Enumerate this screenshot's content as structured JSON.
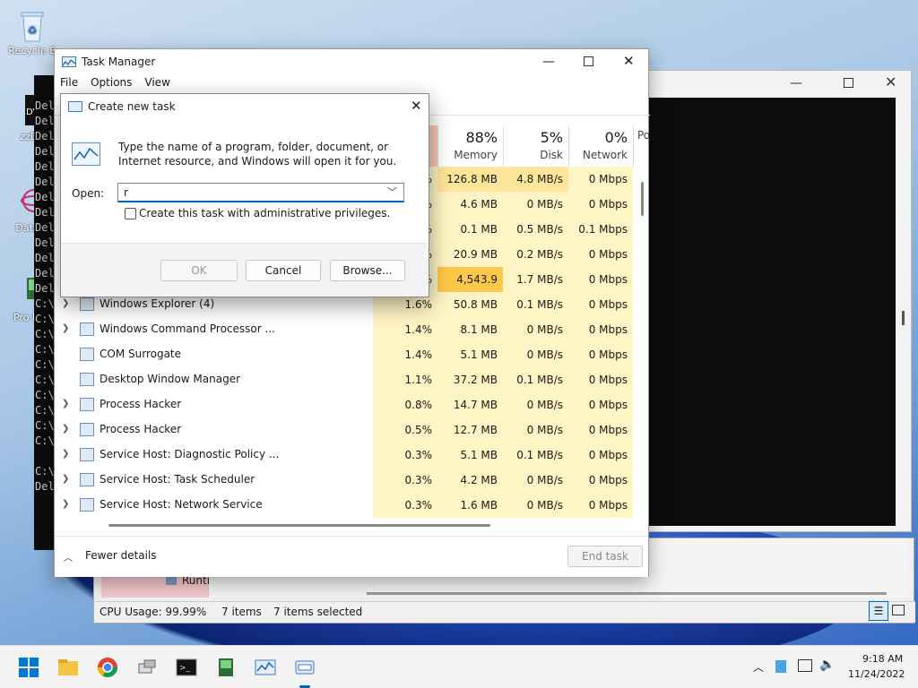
{
  "desktop": {
    "icons": [
      {
        "label": "Recycle B"
      },
      {
        "label": "zzDV"
      },
      {
        "label": "DataW"
      },
      {
        "label": "Pro Hac"
      }
    ],
    "cmd_lines": [
      "Del",
      "Del",
      "Del",
      "Del",
      "Del",
      "Del",
      "Del",
      "Del",
      "Del",
      "Del",
      "Del",
      "Del",
      "Del",
      "C:\\",
      "C:\\",
      "C:\\",
      "C:\\",
      "C:\\",
      "C:\\",
      "C:\\",
      "C:\\",
      "C:\\",
      "C:\\",
      "",
      "C:\\",
      "Del"
    ]
  },
  "task_manager": {
    "title": "Task Manager",
    "menu": [
      "File",
      "Options",
      "View"
    ],
    "columns": [
      {
        "pct": "88%",
        "name": "Memory"
      },
      {
        "pct": "5%",
        "name": "Disk"
      },
      {
        "pct": "0%",
        "name": "Network"
      },
      {
        "pct": "",
        "name": "Po"
      }
    ],
    "rows": [
      {
        "name": "",
        "cpu": "%",
        "mem": "126.8 MB",
        "disk": "4.8 MB/s",
        "net": "0 Mbps",
        "expand": false
      },
      {
        "name": "",
        "cpu": "%",
        "mem": "4.6 MB",
        "disk": "0 MB/s",
        "net": "0 Mbps",
        "expand": false
      },
      {
        "name": "",
        "cpu": "%",
        "mem": "0.1 MB",
        "disk": "0.5 MB/s",
        "net": "0.1 Mbps",
        "expand": false
      },
      {
        "name": "",
        "cpu": "%",
        "mem": "20.9 MB",
        "disk": "0.2 MB/s",
        "net": "0 Mbps",
        "expand": false
      },
      {
        "name": "",
        "cpu": "%",
        "mem": "4,543.9 MB",
        "disk": "1.7 MB/s",
        "net": "0 Mbps",
        "expand": false
      },
      {
        "name": "Windows Explorer (4)",
        "cpu": "1.6%",
        "mem": "50.8 MB",
        "disk": "0.1 MB/s",
        "net": "0 Mbps",
        "expand": true
      },
      {
        "name": "Windows Command Processor ...",
        "cpu": "1.4%",
        "mem": "8.1 MB",
        "disk": "0 MB/s",
        "net": "0 Mbps",
        "expand": true
      },
      {
        "name": "COM Surrogate",
        "cpu": "1.4%",
        "mem": "5.1 MB",
        "disk": "0 MB/s",
        "net": "0 Mbps",
        "expand": false
      },
      {
        "name": "Desktop Window Manager",
        "cpu": "1.1%",
        "mem": "37.2 MB",
        "disk": "0.1 MB/s",
        "net": "0 Mbps",
        "expand": false
      },
      {
        "name": "Process Hacker",
        "cpu": "0.8%",
        "mem": "14.7 MB",
        "disk": "0 MB/s",
        "net": "0 Mbps",
        "expand": true
      },
      {
        "name": "Process Hacker",
        "cpu": "0.5%",
        "mem": "12.7 MB",
        "disk": "0 MB/s",
        "net": "0 Mbps",
        "expand": true
      },
      {
        "name": "Service Host: Diagnostic Policy ...",
        "cpu": "0.3%",
        "mem": "5.1 MB",
        "disk": "0.1 MB/s",
        "net": "0 Mbps",
        "expand": true
      },
      {
        "name": "Service Host: Task Scheduler",
        "cpu": "0.3%",
        "mem": "4.2 MB",
        "disk": "0 MB/s",
        "net": "0 Mbps",
        "expand": true
      },
      {
        "name": "Service Host: Network Service",
        "cpu": "0.3%",
        "mem": "1.6 MB",
        "disk": "0 MB/s",
        "net": "0 Mbps",
        "expand": true
      }
    ],
    "fewer_details": "Fewer details",
    "end_task": "End task"
  },
  "dialog": {
    "title": "Create new task",
    "description": "Type the name of a program, folder, document, or Internet resource, and Windows will open it for you.",
    "open_label": "Open:",
    "open_value": "r",
    "admin_label": "Create this task with administrative privileges.",
    "ok": "OK",
    "cancel": "Cancel",
    "browse": "Browse..."
  },
  "process_hacker": {
    "tree_item": "Runti",
    "cpu_usage": "CPU Usage: 99.99%",
    "items": "7 items",
    "selected": "7 items selected"
  },
  "taskbar": {
    "time": "9:18 AM",
    "date": "11/24/2022"
  },
  "colors": {
    "heat_light": "#fff4c4",
    "heat_medium": "#ffe69a",
    "heat_high": "#ffc84a",
    "accent": "#0067c0",
    "cmd_bg": "#0c0c0c"
  }
}
